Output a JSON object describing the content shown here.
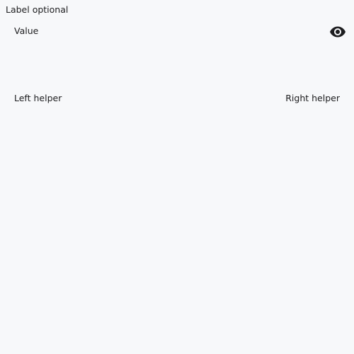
{
  "field": {
    "label": "Label optional",
    "value": "Value",
    "helper_left": "Left helper",
    "helper_right": "Right helper",
    "toggle_icon": "eye-icon"
  },
  "colors": {
    "background": "#f7f8fa",
    "text": "#1d1d1f",
    "icon": "#1d1d1f"
  }
}
